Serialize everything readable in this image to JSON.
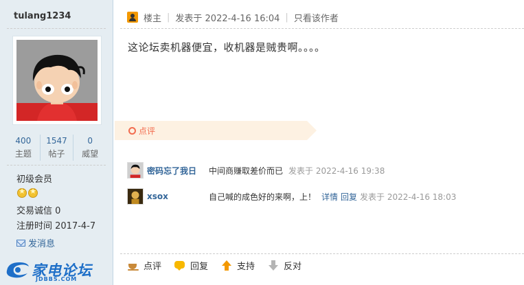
{
  "user": {
    "name": "tulang1234",
    "stats": [
      {
        "value": "400",
        "label": "主题"
      },
      {
        "value": "1547",
        "label": "帖子"
      },
      {
        "value": "0",
        "label": "威望"
      }
    ],
    "rank": "初级会员",
    "star_count": 2,
    "credit": "交易诚信  0",
    "register_time": "注册时间  2017-4-7",
    "send_message": "发消息"
  },
  "logo": {
    "text": "家电论坛",
    "sub": "JDBBS.COM"
  },
  "post": {
    "floor": "楼主",
    "posted_at": "发表于 2022-4-16 16:04",
    "only_author": "只看该作者",
    "content": "这论坛卖机器便宜，收机器是贼贵啊。。。。"
  },
  "comments_section": {
    "label": "点评",
    "items": [
      {
        "author": "密码忘了我日",
        "text": "中间商赚取差价而已",
        "detail": "",
        "reply": "",
        "time": "发表于 2022-4-16 19:38"
      },
      {
        "author": "xsox",
        "text": "自己喊的成色好的来啊，上！",
        "detail": "详情",
        "reply": "回复",
        "time": "发表于 2022-4-16 18:03"
      }
    ]
  },
  "actions": {
    "comment": "点评",
    "reply": "回复",
    "support": "支持",
    "oppose": "反对"
  },
  "colors": {
    "link": "#336699",
    "accent": "#f26c4f",
    "panel_bg": "#e5edf2"
  }
}
